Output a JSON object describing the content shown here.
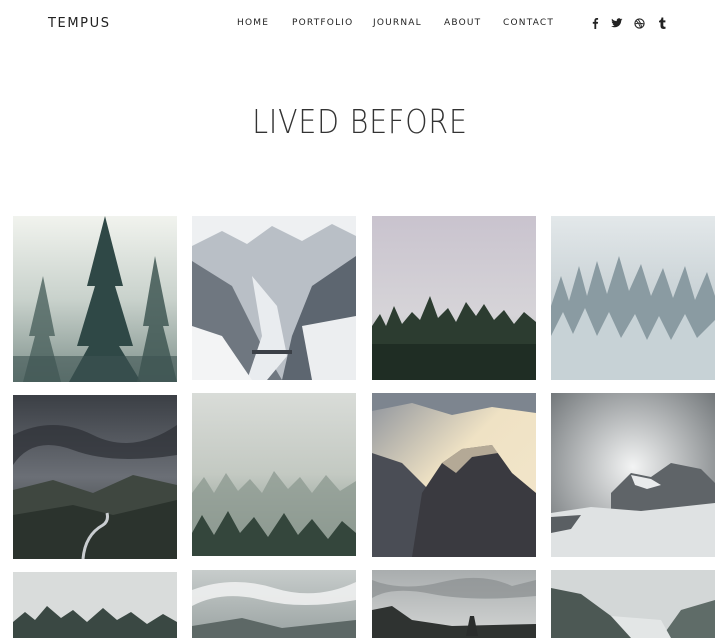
{
  "header": {
    "logo": "TEMPUS",
    "nav": [
      "HOME",
      "PORTFOLIO",
      "JOURNAL",
      "ABOUT",
      "CONTACT"
    ],
    "social_icons": [
      "facebook-icon",
      "twitter-icon",
      "dribbble-icon",
      "tumblr-icon"
    ]
  },
  "page": {
    "title": "LIVED BEFORE"
  },
  "gallery": {
    "photos": [
      "misty-pine-forest",
      "snowy-mountain-valley",
      "foggy-forest-treeline",
      "snow-covered-trees",
      "stormy-road-hills",
      "fog-over-forest",
      "sunlit-mountain-ridge",
      "snowy-peak-in-clouds",
      "misty-hills-forest",
      "cloudy-sky-ridge",
      "overcast-tower",
      "mountain-valley-fog"
    ]
  },
  "colors": {
    "text": "#222222",
    "title": "#333333",
    "background": "#ffffff"
  }
}
